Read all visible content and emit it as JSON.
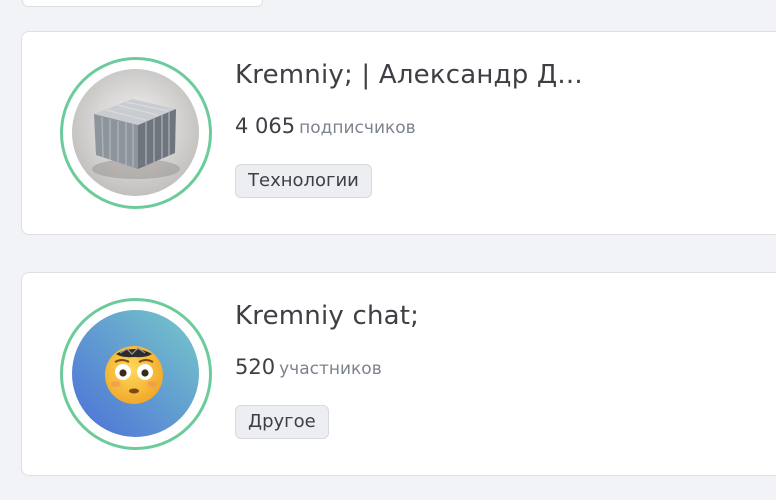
{
  "channels": [
    {
      "name": "Kremniy; | Александр Д...",
      "count": "4 065",
      "count_label": "подписчиков",
      "tag": "Технологии",
      "avatar_icon": "metal-cube-icon"
    },
    {
      "name": "Kremniy chat;",
      "count": "520",
      "count_label": "участников",
      "tag": "Другое",
      "avatar_icon": "flushed-face-emoji-icon"
    }
  ],
  "colors": {
    "page_background": "#f2f3f6",
    "card_background": "#ffffff",
    "avatar_ring": "#6ccb9a",
    "tag_background": "#eceef2",
    "primary_text": "#3d3f44",
    "secondary_text": "#7d838d"
  }
}
